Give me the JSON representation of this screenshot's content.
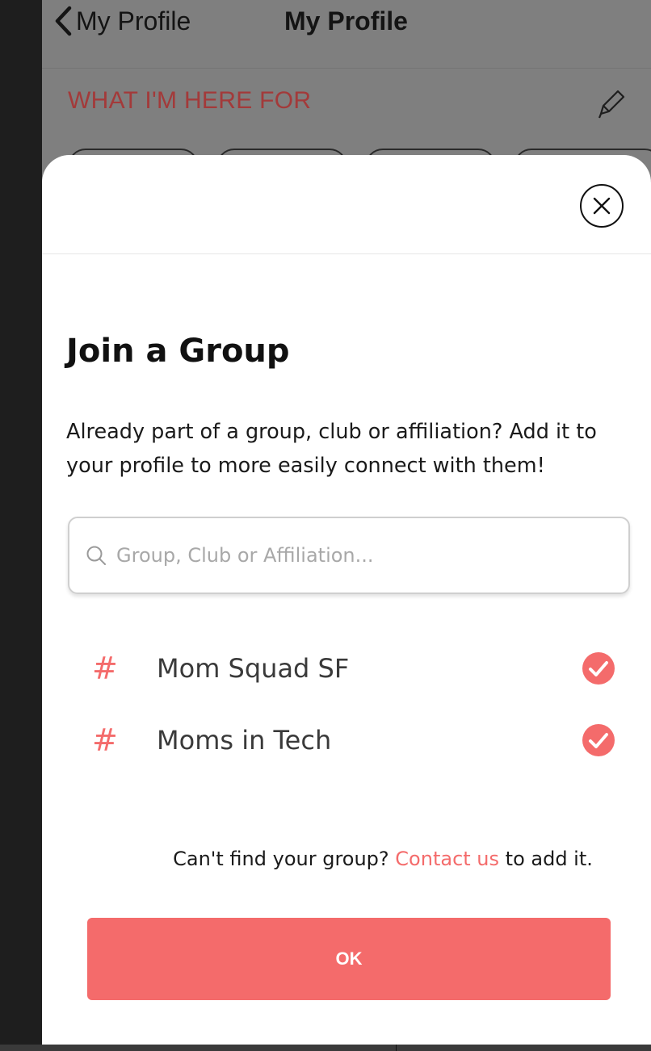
{
  "nav": {
    "back_label": "My Profile",
    "title": "My Profile"
  },
  "profile": {
    "section_heading": "WHAT I'M HERE FOR"
  },
  "modal": {
    "title": "Join a Group",
    "description": "Already part of a group, club or affiliation? Add it to your profile to more easily connect with them!",
    "search_placeholder": "Group, Club or Affiliation...",
    "groups": [
      {
        "name": "Mom Squad SF",
        "selected": true
      },
      {
        "name": "Moms in Tech",
        "selected": true
      }
    ],
    "help": {
      "prefix": "Can't find your group?",
      "link": "Contact us",
      "suffix": "to add it."
    },
    "ok_label": "OK"
  },
  "colors": {
    "accent": "#f46b6b",
    "heading_dimmed": "#a33a3a",
    "overlay": "#7f7f7f"
  }
}
